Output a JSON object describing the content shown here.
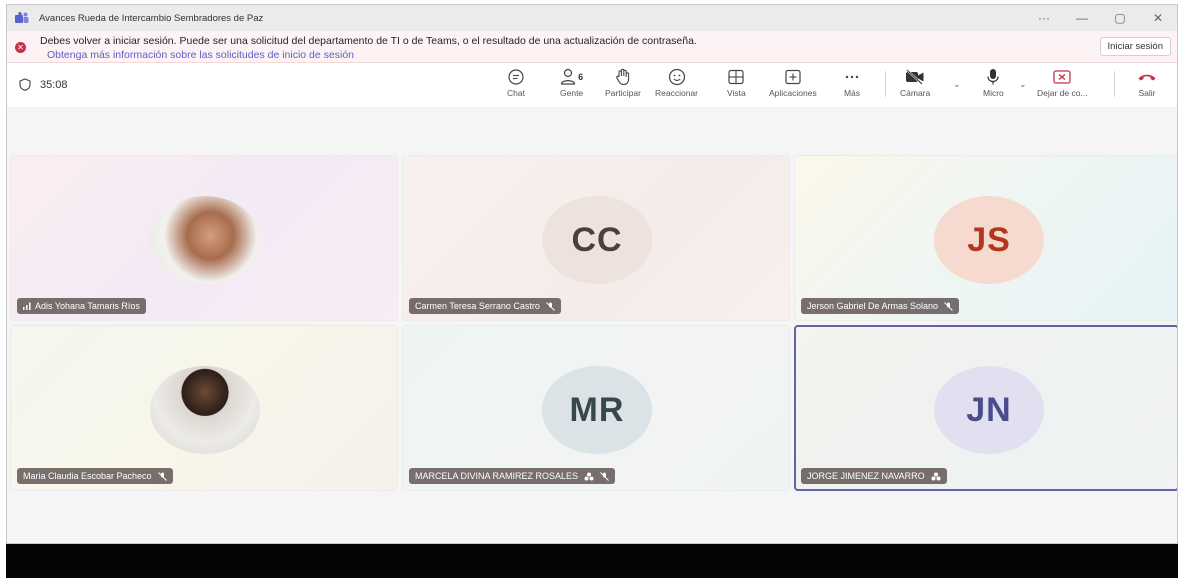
{
  "window": {
    "title": "Avances Rueda de Intercambio Sembradores de Paz",
    "controls": {
      "more": "···",
      "minimize": "—",
      "restore": "▢",
      "close": "✕"
    }
  },
  "banner": {
    "message": "Debes volver a iniciar sesión. Puede ser una solicitud del departamento de TI o de Teams, o el resultado de una actualización de contraseña.",
    "link": "Obtenga más información sobre las solicitudes de inicio de sesión",
    "button": "Iniciar sesión",
    "icon": "error-icon",
    "color": "#c4314b"
  },
  "toolbar": {
    "timer": "35:08",
    "people_count": "6",
    "buttons": {
      "chat": "Chat",
      "people": "Gente",
      "raise": "Participar",
      "react": "Reaccionar",
      "view": "Vista",
      "apps": "Aplicaciones",
      "more": "Más",
      "camera": "Cámara",
      "mic": "Micro",
      "share": "Dejar de co...",
      "leave": "Salir"
    },
    "leave_color": "#c4314b"
  },
  "participants": [
    {
      "name": "Adis Yohana Tamaris Ríos",
      "type": "photo",
      "muted": false,
      "signal": true,
      "hand": false
    },
    {
      "name": "Carmen Teresa Serrano Castro",
      "initials": "CC",
      "avatar_bg": "#ede2dd",
      "muted": true
    },
    {
      "name": "Jerson Gabriel De Armas Solano",
      "initials": "JS",
      "avatar_bg": "#f6d9cf",
      "initials_color": "#b2361c",
      "muted": true
    },
    {
      "name": "Maria Claudia Escobar Pacheco",
      "type": "photo",
      "muted": true
    },
    {
      "name": "MARCELA DIVINA RAMIREZ ROSALES",
      "initials": "MR",
      "avatar_bg": "#dbe3e6",
      "muted": true,
      "hand": true
    },
    {
      "name": "JORGE JIMENEZ NAVARRO",
      "initials": "JN",
      "avatar_bg": "#e2e0f0",
      "initials_color": "#4a4c8c",
      "muted": false,
      "hand": true,
      "active": true
    }
  ]
}
